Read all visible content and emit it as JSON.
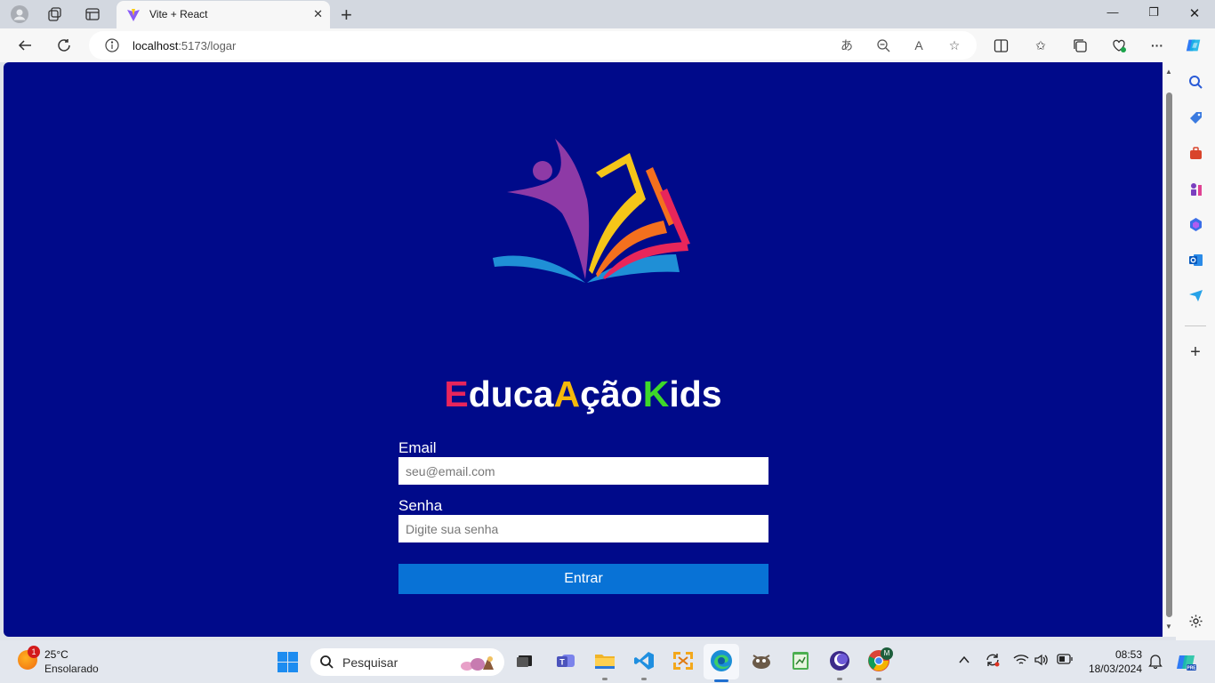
{
  "browser": {
    "tab_title": "Vite + React",
    "url_host": "localhost",
    "url_path": ":5173/logar",
    "colors": {
      "chrome": "#d3d8e0",
      "toolbar": "#f7f7f7"
    }
  },
  "page": {
    "background": "#000a8a",
    "brand": {
      "part1": "E",
      "part2": "duca",
      "part3": "A",
      "part4": "ção",
      "part5": "K",
      "part6": "ids"
    },
    "email_label": "Email",
    "email_placeholder": "seu@email.com",
    "password_label": "Senha",
    "password_placeholder": "Digite sua senha",
    "submit_label": "Entrar"
  },
  "taskbar": {
    "weather_badge": "1",
    "temperature": "25°C",
    "condition": "Ensolarado",
    "search_placeholder": "Pesquisar",
    "time": "08:53",
    "date": "18/03/2024",
    "chrome_badge": "M"
  }
}
